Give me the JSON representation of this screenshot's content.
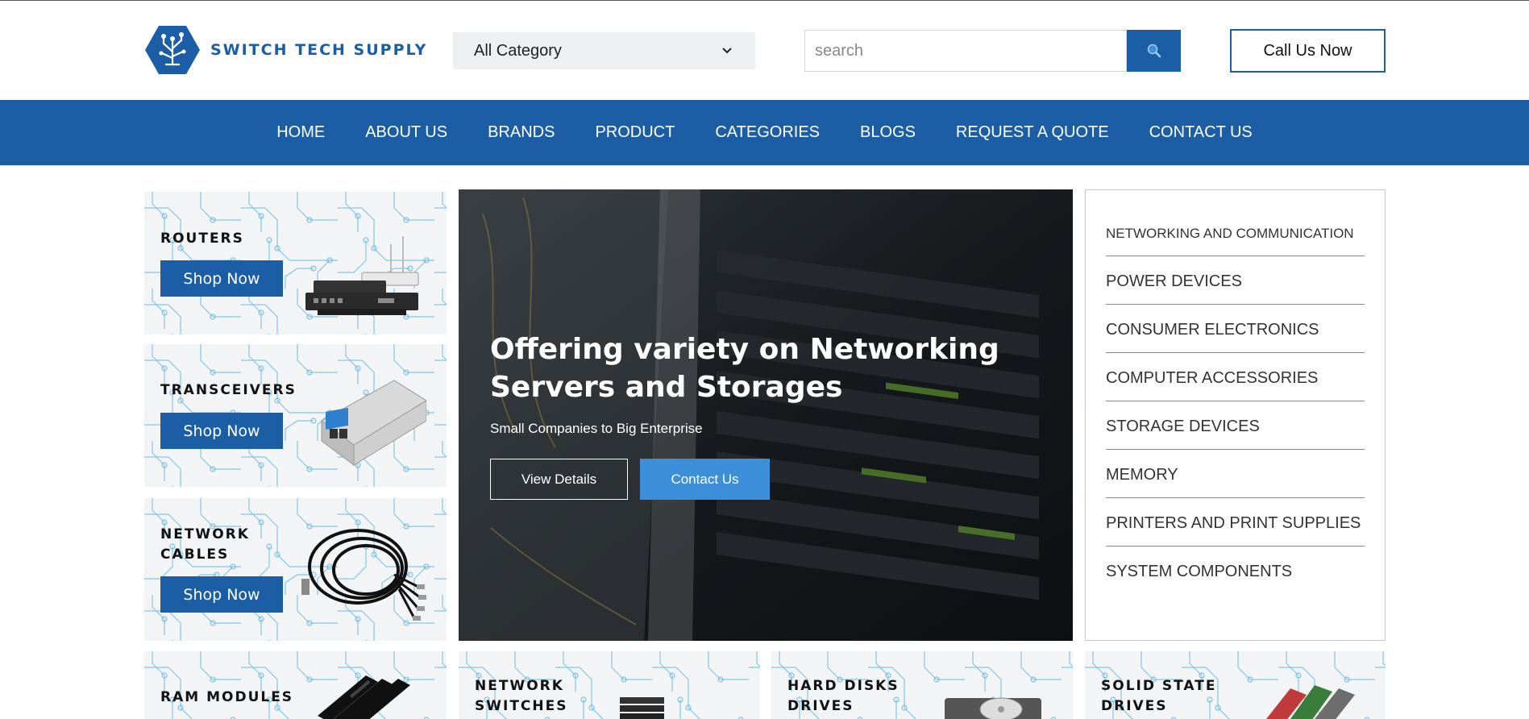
{
  "header": {
    "logo_text": "SWITCH TECH SUPPLY",
    "category_select": {
      "selected": "All Category"
    },
    "search": {
      "placeholder": "search"
    },
    "call_label": "Call Us Now"
  },
  "nav": {
    "items": [
      "HOME",
      "ABOUT US",
      "BRANDS",
      "PRODUCT",
      "CATEGORIES",
      "BLOGS",
      "REQUEST A QUOTE",
      "CONTACT US"
    ]
  },
  "tiles": {
    "routers": {
      "title": "ROUTERS",
      "button": "Shop Now"
    },
    "transceivers": {
      "title": "TRANSCEIVERS",
      "button": "Shop Now"
    },
    "network_cables": {
      "title_line1": "NETWORK",
      "title_line2": "CABLES",
      "button": "Shop Now"
    },
    "ram_modules": {
      "title": "RAM MODULES"
    },
    "network_switches": {
      "title_line1": "NETWORK",
      "title_line2": "SWITCHES"
    },
    "hard_disks": {
      "title_line1": "HARD DISKS",
      "title_line2": "DRIVES"
    },
    "ssd": {
      "title_line1": "SOLID STATE",
      "title_line2": "DRIVES"
    }
  },
  "hero": {
    "title": "Offering variety on Networking Servers and Storages",
    "subtitle": "Small Companies to Big Enterprise",
    "view_details": "View Details",
    "contact_us": "Contact Us"
  },
  "categories": [
    "NETWORKING AND COMMUNICATION",
    "POWER DEVICES",
    "CONSUMER ELECTRONICS",
    "COMPUTER ACCESSORIES",
    "STORAGE DEVICES",
    "MEMORY",
    "PRINTERS AND PRINT SUPPLIES",
    "SYSTEM COMPONENTS"
  ],
  "colors": {
    "brand_blue": "#1b5ea6",
    "accent_blue": "#3d8fd9",
    "tile_bg": "#f2f4f5"
  },
  "icons": {
    "search": "search-icon",
    "dropdown": "chevron-down-icon"
  }
}
